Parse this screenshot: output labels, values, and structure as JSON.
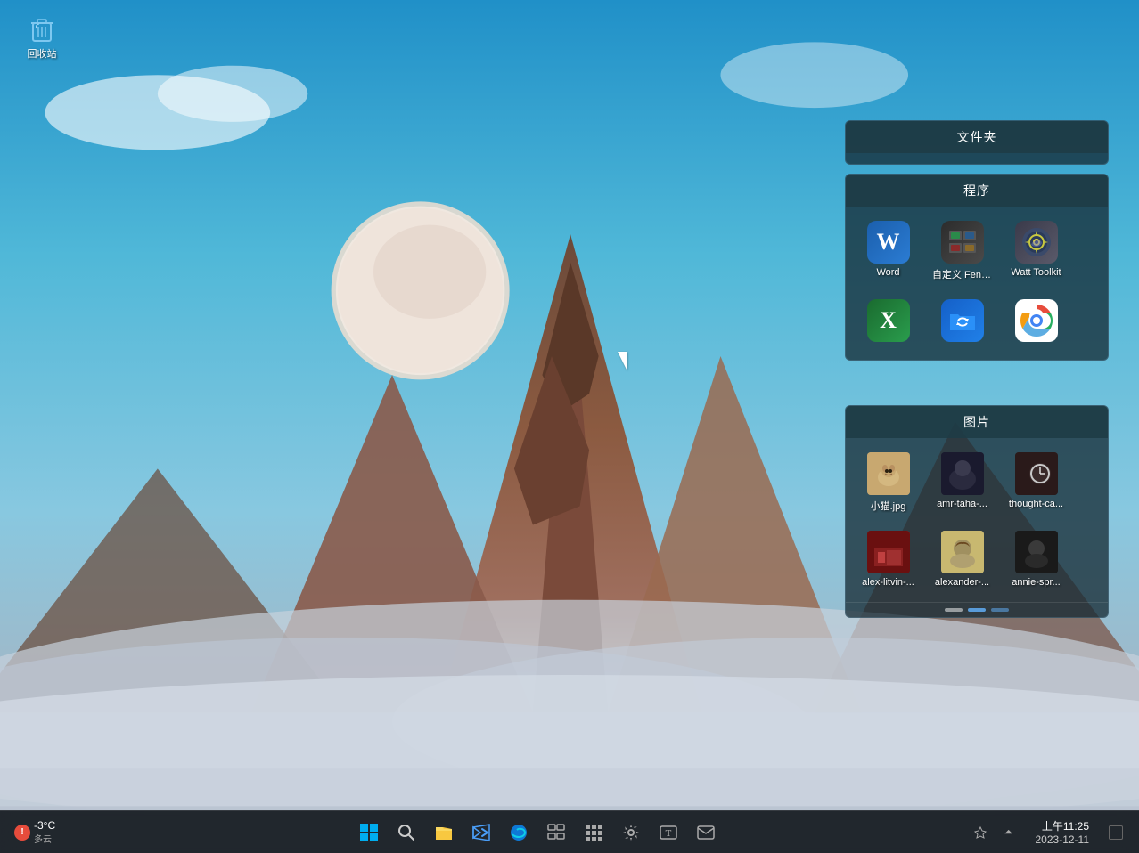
{
  "desktop": {
    "recycle_bin_label": "回收站"
  },
  "fence_folder": {
    "title": "文件夹"
  },
  "fence_programs": {
    "title": "程序",
    "items": [
      {
        "id": "word",
        "label": "Word",
        "icon_type": "word"
      },
      {
        "id": "fences",
        "label": "自定义 Fences",
        "icon_type": "fences"
      },
      {
        "id": "watt",
        "label": "Watt Toolkit",
        "icon_type": "watt"
      },
      {
        "id": "excel",
        "label": "",
        "icon_type": "excel"
      },
      {
        "id": "folder-blue",
        "label": "",
        "icon_type": "folder"
      },
      {
        "id": "chrome",
        "label": "",
        "icon_type": "chrome"
      }
    ]
  },
  "fence_pictures": {
    "title": "图片",
    "items": [
      {
        "id": "cat",
        "label": "小猫.jpg",
        "thumb": "cat"
      },
      {
        "id": "amr",
        "label": "amr-taha-...",
        "thumb": "dark"
      },
      {
        "id": "thought",
        "label": "thought-ca...",
        "thumb": "watch"
      },
      {
        "id": "alex-l",
        "label": "alex-litvin-...",
        "thumb": "red"
      },
      {
        "id": "alexander",
        "label": "alexander-...",
        "thumb": "hair"
      },
      {
        "id": "annie",
        "label": "annie-spr...",
        "thumb": "dark2"
      }
    ]
  },
  "taskbar": {
    "weather_temp": "-3°C",
    "weather_desc": "多云",
    "time": "上午11:25",
    "date": "2023-12-11",
    "icons": [
      {
        "id": "start",
        "symbol": "⊞",
        "label": "开始"
      },
      {
        "id": "search",
        "symbol": "🔍",
        "label": "搜索"
      },
      {
        "id": "explorer",
        "symbol": "📁",
        "label": "文件管理器"
      },
      {
        "id": "vscode",
        "symbol": "◈",
        "label": "VS Code"
      },
      {
        "id": "edge",
        "symbol": "⬡",
        "label": "Edge"
      },
      {
        "id": "fences-tb",
        "symbol": "⊟",
        "label": "Fences"
      },
      {
        "id": "taskbar-icon6",
        "symbol": "⊞",
        "label": "图标6"
      },
      {
        "id": "settings",
        "symbol": "⚙",
        "label": "设置"
      },
      {
        "id": "typora",
        "symbol": "◧",
        "label": "Typora"
      },
      {
        "id": "email",
        "symbol": "✉",
        "label": "邮件"
      }
    ]
  }
}
